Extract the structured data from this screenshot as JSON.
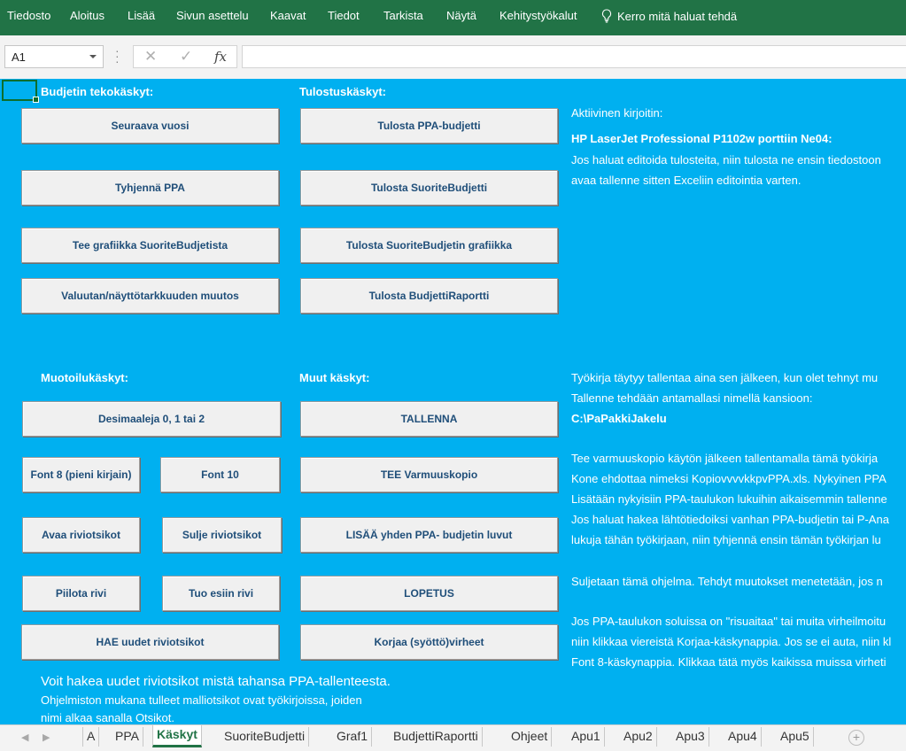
{
  "ribbon": {
    "tabs": [
      "Tiedosto",
      "Aloitus",
      "Lisää",
      "Sivun asettelu",
      "Kaavat",
      "Tiedot",
      "Tarkista",
      "Näytä",
      "Kehitystyökalut"
    ],
    "tell_me": "Kerro mitä haluat tehdä",
    "tell_me_icon": "lightbulb-icon"
  },
  "formula_bar": {
    "name_box": "A1",
    "cancel_icon": "✕",
    "enter_icon": "✓",
    "fx_label": "fx",
    "formula": ""
  },
  "headers": {
    "budget": "Budjetin tekokäskyt:",
    "print": "Tulostuskäskyt:",
    "format": "Muotoilukäskyt:",
    "other": "Muut käskyt:"
  },
  "buttons": {
    "next_year": "Seuraava vuosi",
    "clear_ppa": "Tyhjennä PPA",
    "make_graphics": "Tee grafiikka SuoriteBudjetista",
    "currency": "Valuutan/näyttötarkkuuden muutos",
    "print_ppa": "Tulosta PPA-budjetti",
    "print_suorite": "Tulosta SuoriteBudjetti",
    "print_suorite_graphics": "Tulosta SuoriteBudjetin grafiikka",
    "print_report": "Tulosta BudjettiRaportti",
    "decimals": "Desimaaleja 0, 1 tai 2",
    "font8": "Font 8 (pieni kirjain)",
    "font10": "Font 10",
    "open_headers": "Avaa riviotsikot",
    "close_headers": "Sulje riviotsikot",
    "hide_row": "Piilota rivi",
    "show_row": "Tuo esiin rivi",
    "fetch_headers": "HAE uudet riviotsikot",
    "save": "TALLENNA",
    "backup": "TEE Varmuuskopio",
    "add_ppa": "LISÄÄ yhden PPA- budjetin luvut",
    "exit": "LOPETUS",
    "fix_errors": "Korjaa (syöttö)virheet"
  },
  "info": {
    "active_printer_label": "Aktiivinen kirjoitin:",
    "printer_name": "HP LaserJet Professional P1102w porttiin Ne04:",
    "print_edit_1": "Jos haluat editoida tulosteita, niin tulosta ne ensin tiedostoon",
    "print_edit_2": "avaa tallenne sitten Exceliin editointia varten.",
    "save_1": "Työkirja täytyy tallentaa aina sen jälkeen, kun olet tehnyt mu",
    "save_2": "Tallenne tehdään antamallasi nimellä kansioon:",
    "save_path": "C:\\PaPakkiJakelu",
    "backup_1": "Tee varmuuskopio käytön jälkeen tallentamalla tämä työkirja",
    "backup_2": "Kone ehdottaa nimeksi KopiovvvvkkpvPPA.xls. Nykyinen PPA",
    "add_1": "Lisätään nykyisiin PPA-taulukon lukuihin aikaisemmin tallenne",
    "add_2": "Jos haluat hakea lähtötiedoiksi vanhan PPA-budjetin tai P-Ana",
    "add_3": "lukuja tähän työkirjaan, niin tyhjennä ensin tämän työkirjan lu",
    "exit_1": "Suljetaan tämä ohjelma. Tehdyt muutokset menetetään, jos n",
    "fix_1": "Jos PPA-taulukon soluissa on \"risuaitaa\" tai muita virheilmoitu",
    "fix_2": "niin klikkaa viereistä Korjaa-käskynappia. Jos se ei auta, niin kl",
    "fix_3": "Font 8-käskynappia. Klikkaa tätä myös kaikissa muissa virheti",
    "headers_big": "Voit hakea uudet riviotsikot mistä tahansa PPA-tallenteesta.",
    "headers_1": "Ohjelmiston mukana tulleet malliotsikot ovat työkirjoissa, joiden",
    "headers_2": "nimi alkaa sanalla Otsikot."
  },
  "sheet_tabs": {
    "items": [
      "A",
      "PPA",
      "Käskyt",
      "SuoriteBudjetti",
      "Graf1",
      "BudjettiRaportti",
      "Ohjeet",
      "Apu1",
      "Apu2",
      "Apu3",
      "Apu4",
      "Apu5"
    ],
    "active": "Käskyt",
    "add_label": "+"
  },
  "colors": {
    "ribbon": "#217346",
    "sheet_background": "#00b0f0",
    "button_text": "#1f4e79"
  }
}
